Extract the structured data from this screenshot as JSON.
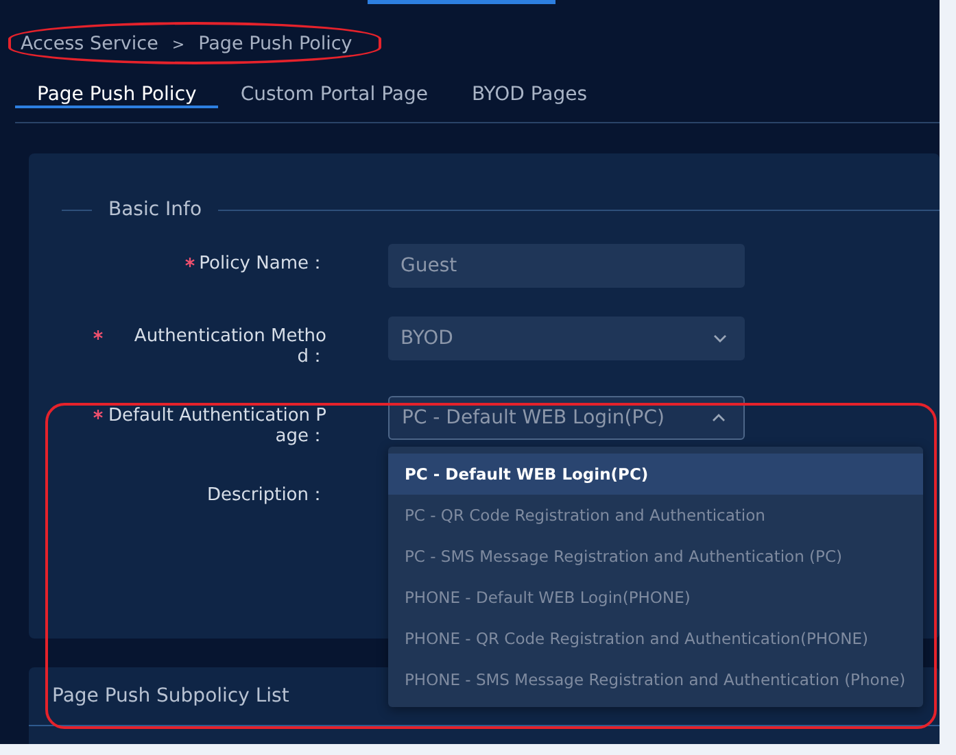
{
  "breadcrumb": {
    "items": [
      "Access Service",
      "Page Push Policy"
    ],
    "separator": ">"
  },
  "tabs": [
    {
      "label": "Page Push Policy",
      "selected": true
    },
    {
      "label": "Custom Portal Page",
      "selected": false
    },
    {
      "label": "BYOD Pages",
      "selected": false
    }
  ],
  "basic_info": {
    "title": "Basic Info",
    "fields": [
      {
        "label": "Policy Name：",
        "required": true,
        "kind": "input",
        "value": "Guest"
      },
      {
        "label": "Authentication Method：",
        "required": true,
        "kind": "select",
        "value": "BYOD",
        "expanded": false
      },
      {
        "label": "Default Authentication Page：",
        "required": true,
        "kind": "select",
        "value": "PC - Default WEB Login(PC)",
        "expanded": true,
        "options": [
          {
            "label": "PC - Default WEB Login(PC)",
            "selected": true
          },
          {
            "label": "PC - QR Code Registration and Authentication",
            "selected": false
          },
          {
            "label": "PC - SMS Message Registration and Authentication (PC)",
            "selected": false
          },
          {
            "label": "PHONE - Default WEB Login(PHONE)",
            "selected": false
          },
          {
            "label": "PHONE - QR Code Registration and Authentication(PHONE)",
            "selected": false
          },
          {
            "label": "PHONE - SMS Message Registration and Authentication (Phone)",
            "selected": false
          }
        ]
      },
      {
        "label": "Description：",
        "required": false,
        "kind": "hidden"
      }
    ]
  },
  "subpolicy_panel": {
    "title": "Page Push Subpolicy List"
  }
}
